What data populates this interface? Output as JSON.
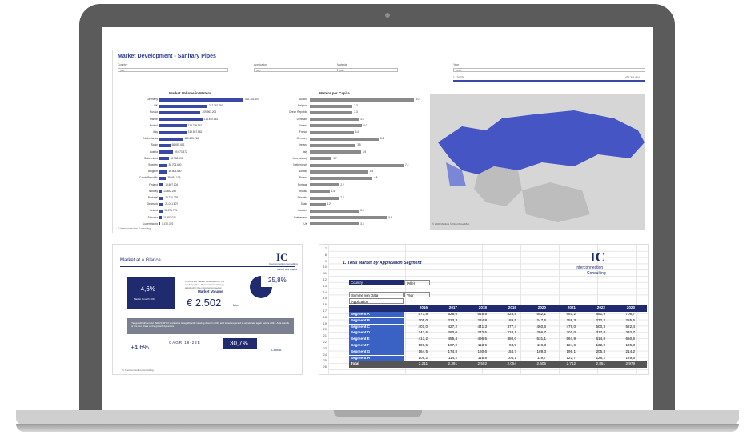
{
  "dashboard": {
    "title": "Market Development - Sanitary Pipes",
    "filters": [
      {
        "label": "Country",
        "value": "(All)"
      },
      {
        "label": "Application",
        "value": "(All)"
      },
      {
        "label": "Material",
        "value": "(All)"
      },
      {
        "label": "Year",
        "value": "2016"
      }
    ],
    "slider": {
      "min": "1.470.376",
      "max": "432.341.604"
    },
    "volume_chart": {
      "title": "Market Volume in Meters",
      "rows": [
        [
          "Germany",
          "432.341.604",
          100
        ],
        [
          "UK",
          "247.767.760",
          57
        ],
        [
          "Russia",
          "209.963.205",
          49
        ],
        [
          "France",
          "218.610.861",
          51
        ],
        [
          "Poland",
          "138.798.867",
          32
        ],
        [
          "Italy",
          "138.567.962",
          32
        ],
        [
          "Netherlands",
          "120.805.769",
          28
        ],
        [
          "Spain",
          "56.687.651",
          13
        ],
        [
          "Austria",
          "69.073.372",
          16
        ],
        [
          "Switzerland",
          "48.908.591",
          11
        ],
        [
          "Sweden",
          "38.704.600",
          9
        ],
        [
          "Belgium",
          "36.803.860",
          9
        ],
        [
          "Czech Republic",
          "35.461.105",
          8
        ],
        [
          "Finland",
          "19.807.104",
          5
        ],
        [
          "Norway",
          "13.892.242",
          3
        ],
        [
          "Portugal",
          "22.720.228",
          5
        ],
        [
          "Denmark",
          "21.041.607",
          5
        ],
        [
          "Ireland",
          "16.076.775",
          4
        ],
        [
          "Slovakia",
          "11.457.021",
          3
        ],
        [
          "Luxembourg",
          "1.470.376",
          1
        ]
      ]
    },
    "capita_chart": {
      "title": "Meters per Capita",
      "rows": [
        [
          "Austria",
          "8.0",
          100
        ],
        [
          "Belgium",
          "3.3",
          41
        ],
        [
          "Czech Republic",
          "3.3",
          41
        ],
        [
          "Denmark",
          "3.8",
          47
        ],
        [
          "Finland",
          "4.0",
          50
        ],
        [
          "France",
          "3.4",
          42
        ],
        [
          "Germany",
          "5.3",
          66
        ],
        [
          "Ireland",
          "3.5",
          44
        ],
        [
          "Italy",
          "3.9",
          49
        ],
        [
          "Luxembourg",
          "1.7",
          21
        ],
        [
          "Netherlands",
          "7.2",
          90
        ],
        [
          "Norway",
          "4.5",
          56
        ],
        [
          "Poland",
          "4.8",
          60
        ],
        [
          "Portugal",
          "2.2",
          28
        ],
        [
          "Russia",
          "1.5",
          19
        ],
        [
          "Slovakia",
          "2.2",
          28
        ],
        [
          "Spain",
          "1.2",
          15
        ],
        [
          "Sweden",
          "3.8",
          47
        ],
        [
          "Switzerland",
          "5.9",
          74
        ],
        [
          "UK",
          "3.8",
          47
        ]
      ]
    },
    "footer": "© Interconnection Consulting",
    "map_credit": "© 2020 Mapbox © OpenStreetMap"
  },
  "glance": {
    "title": "Market at a Glance",
    "logo": "IC",
    "logo_sub": "Interconnection Consulting",
    "tagline": "Market at a Glance",
    "growth_pct": "+4,6%",
    "growth_label": "Market Growth 2019",
    "volume_label": "Market Volume",
    "volume_value": "€ 2.502",
    "volume_unit": "Mio.",
    "share_pct": "25,8%",
    "cagr_pct": "+4,6%",
    "cagr_label": "CAGR 19-22E",
    "china_pct": "30,7%",
    "china_label": "CHINA",
    "note": "In 2019 the market developed for the sanitary pipes. Demand was strongly affected by the construction sector.",
    "bar_text": "The growth drivers for INDUSTRY X worldwide is significantly slowing down in 2019 and is not expected to accelerate again before 2021. Asia stands for the lion share of the growth dynamics.",
    "footer": "© Interconnection Consulting"
  },
  "excel": {
    "row_numbers": [
      "7",
      "8",
      "9",
      "10",
      "11",
      "12",
      "13",
      "14",
      "15",
      "16",
      "17",
      "18",
      "19",
      "20",
      "21",
      "22",
      "23",
      "24",
      "25",
      "26"
    ],
    "title": "1. Total Market by Application Segment",
    "logo": "IC",
    "logo_sub1": "Interconnection",
    "logo_sub2": "Consulting",
    "country_label": "Country",
    "country_value": "(Alle)",
    "sum_label": "Summe von Data",
    "year_label": "Year",
    "app_label": "Application",
    "years": [
      "2016",
      "2017",
      "2018",
      "2019",
      "2020",
      "2021",
      "2022",
      "2023"
    ],
    "rows": [
      {
        "name": "Segment A",
        "v": [
          "573,8",
          "628,6",
          "645,5",
          "525,5",
          "652,1",
          "661,2",
          "681,9",
          "706,7"
        ]
      },
      {
        "name": "Segment B",
        "v": [
          "205,0",
          "223,3",
          "234,8",
          "189,5",
          "247,6",
          "259,3",
          "272,2",
          "285,5"
        ]
      },
      {
        "name": "Segment C",
        "v": [
          "401,0",
          "427,2",
          "441,3",
          "377,4",
          "460,6",
          "479,0",
          "500,3",
          "522,4"
        ]
      },
      {
        "name": "Segment D",
        "v": [
          "242,5",
          "260,0",
          "272,5",
          "228,1",
          "286,7",
          "301,0",
          "317,8",
          "332,7"
        ]
      },
      {
        "name": "Segment E",
        "v": [
          "413,2",
          "455,4",
          "496,5",
          "380,0",
          "531,1",
          "567,9",
          "614,8",
          "650,6"
        ]
      },
      {
        "name": "Segment F",
        "v": [
          "100,5",
          "107,2",
          "113,6",
          "94,9",
          "119,3",
          "124,6",
          "132,0",
          "136,8"
        ]
      },
      {
        "name": "Segment G",
        "v": [
          "164,5",
          "174,8",
          "180,6",
          "154,7",
          "189,3",
          "196,1",
          "205,3",
          "214,2"
        ]
      },
      {
        "name": "Segment H",
        "v": [
          "109,2",
          "114,2",
          "116,8",
          "104,1",
          "119,7",
          "122,7",
          "126,2",
          "129,6"
        ]
      }
    ],
    "total": {
      "name": "Total",
      "v": [
        "2.211",
        "2.391",
        "2.502",
        "2.054",
        "2.605",
        "2.712",
        "2.851",
        "2.979"
      ]
    }
  }
}
